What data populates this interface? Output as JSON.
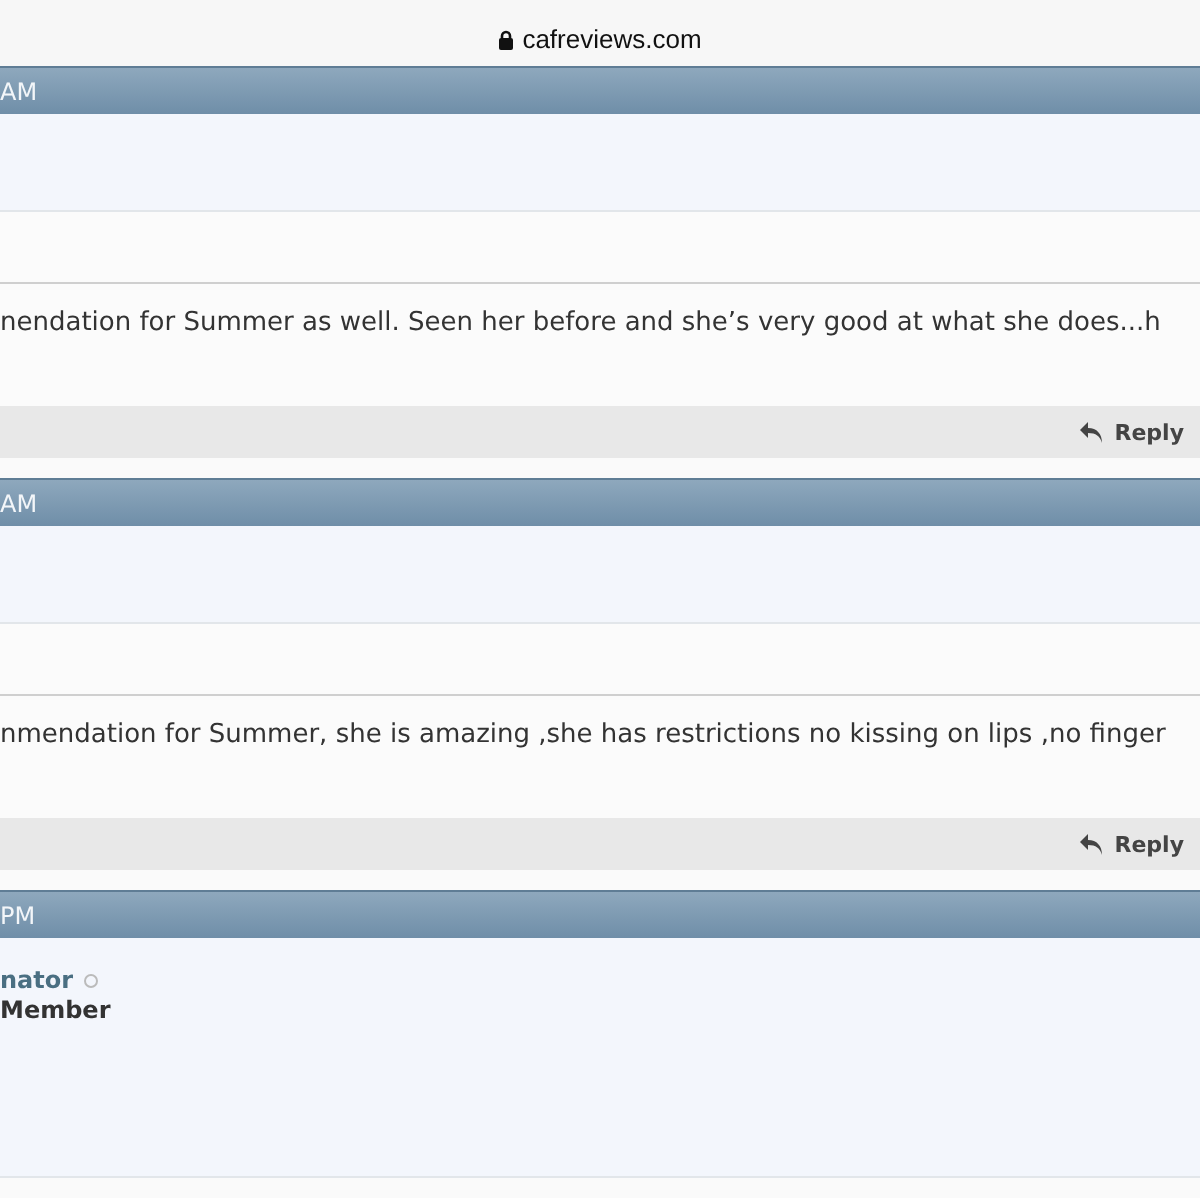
{
  "address_bar": {
    "url": "cafreviews.com"
  },
  "posts": [
    {
      "time": "AM",
      "message": "nendation for Summer as well. Seen her before and she’s very good at what she does...h",
      "reply": "Reply"
    },
    {
      "time": "AM",
      "message": "nmendation for Summer, she is amazing ,she has restrictions no kissing on lips ,no finger",
      "reply": "Reply"
    },
    {
      "time": "PM",
      "author": "nator",
      "online": false,
      "rank": "Member"
    }
  ]
}
